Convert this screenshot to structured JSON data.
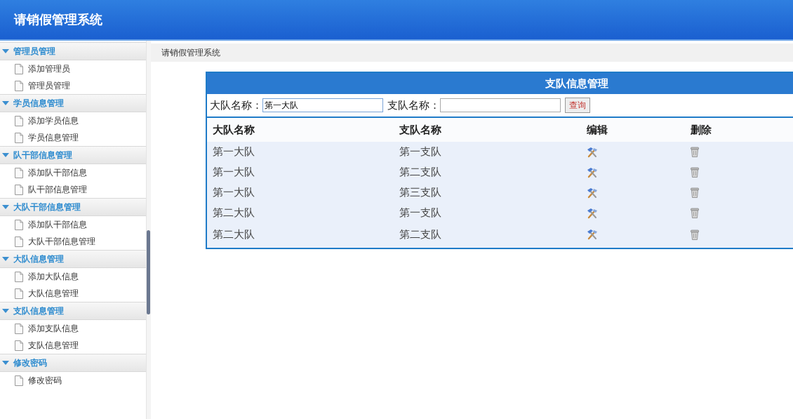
{
  "header": {
    "title": "请销假管理系统"
  },
  "sidebar": {
    "groups": [
      {
        "title": "管理员管理",
        "expanded": true,
        "items": [
          "添加管理员",
          "管理员管理"
        ]
      },
      {
        "title": "学员信息管理",
        "expanded": true,
        "items": [
          "添加学员信息",
          "学员信息管理"
        ]
      },
      {
        "title": "队干部信息管理",
        "expanded": true,
        "items": [
          "添加队干部信息",
          "队干部信息管理"
        ]
      },
      {
        "title": "大队干部信息管理",
        "expanded": true,
        "items": [
          "添加队干部信息",
          "大队干部信息管理"
        ]
      },
      {
        "title": "大队信息管理",
        "expanded": true,
        "items": [
          "添加大队信息",
          "大队信息管理"
        ]
      },
      {
        "title": "支队信息管理",
        "expanded": true,
        "items": [
          "添加支队信息",
          "支队信息管理"
        ]
      },
      {
        "title": "修改密码",
        "expanded": true,
        "items": [
          "修改密码"
        ]
      }
    ]
  },
  "breadcrumb": "请销假管理系统",
  "panel": {
    "title": "支队信息管理",
    "filters": [
      {
        "label": "大队名称：",
        "value": "第一大队"
      },
      {
        "label": "支队名称："
      }
    ],
    "search_button": "查询",
    "table": {
      "columns": [
        "大队名称",
        "支队名称",
        "编辑",
        "删除"
      ],
      "rows": [
        {
          "brigade": "第一大队",
          "detachment": "第一支队"
        },
        {
          "brigade": "第一大队",
          "detachment": "第二支队"
        },
        {
          "brigade": "第一大队",
          "detachment": "第三支队"
        },
        {
          "brigade": "第二大队",
          "detachment": "第一支队"
        },
        {
          "brigade": "第二大队",
          "detachment": "第二支队"
        }
      ]
    }
  }
}
